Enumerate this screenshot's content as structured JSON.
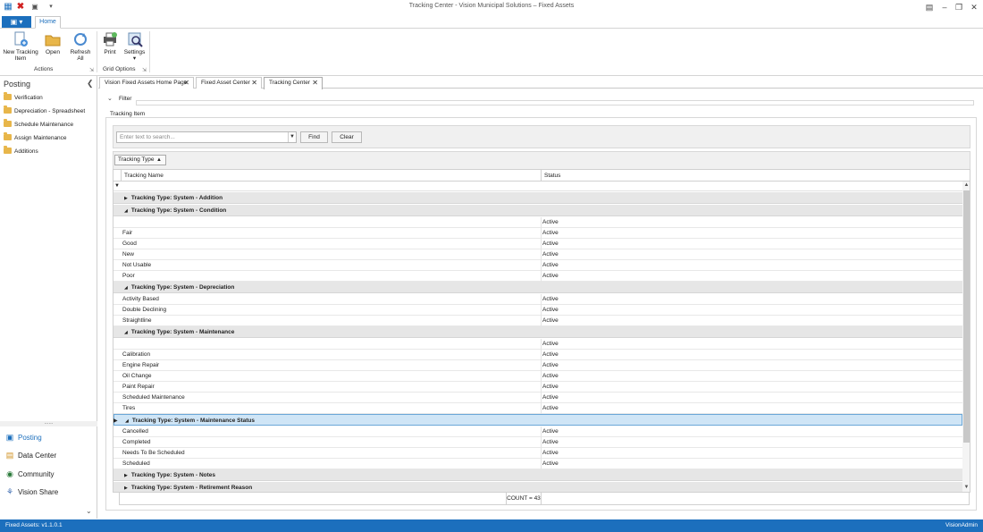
{
  "window": {
    "title": "Tracking Center - Vision Municipal Solutions – Fixed Assets",
    "buttons": [
      "❐",
      "–",
      "❐",
      "✕"
    ]
  },
  "ribbon": {
    "file_tab": "▣ ▾",
    "home_tab": "Home",
    "groups": [
      {
        "label": "Actions",
        "buttons": [
          "New Tracking Item",
          "Open",
          "Refresh All"
        ]
      },
      {
        "label": "Grid Options",
        "buttons": [
          "Print",
          "Settings"
        ]
      }
    ],
    "new_tracking_l1": "New Tracking",
    "new_tracking_l2": "Item",
    "open": "Open",
    "refresh_l1": "Refresh",
    "refresh_l2": "All",
    "print": "Print",
    "settings": "Settings",
    "actions_label": "Actions",
    "grid_options_label": "Grid Options"
  },
  "nav": {
    "title": "Posting",
    "items": [
      "Verification",
      "Depreciation - Spreadsheet",
      "Schedule Maintenance",
      "Assign Maintenance",
      "Additions"
    ],
    "bottom": [
      "Posting",
      "Data Center",
      "Community",
      "Vision Share"
    ]
  },
  "doc_tabs": [
    "Vision Fixed Assets Home Page",
    "Fixed Asset Center",
    "Tracking Center"
  ],
  "filter": {
    "label": "Filter"
  },
  "tracking": {
    "label": "Tracking Item",
    "search_placeholder": "Enter text to search...",
    "find": "Find",
    "clear": "Clear",
    "group_chip": "Tracking Type"
  },
  "grid": {
    "columns": [
      "Tracking Name",
      "Status"
    ],
    "rows": [
      {
        "type": "group",
        "expanded": false,
        "label": "Tracking Type: System - Addition"
      },
      {
        "type": "group",
        "expanded": true,
        "label": "Tracking Type: System - Condition"
      },
      {
        "type": "data",
        "name": "",
        "status": "Active"
      },
      {
        "type": "data",
        "name": "Fair",
        "status": "Active"
      },
      {
        "type": "data",
        "name": "Good",
        "status": "Active"
      },
      {
        "type": "data",
        "name": "New",
        "status": "Active"
      },
      {
        "type": "data",
        "name": "Not Usable",
        "status": "Active"
      },
      {
        "type": "data",
        "name": "Poor",
        "status": "Active"
      },
      {
        "type": "group",
        "expanded": true,
        "label": "Tracking Type: System - Depreciation"
      },
      {
        "type": "data",
        "name": "Activity Based",
        "status": "Active"
      },
      {
        "type": "data",
        "name": "Double Declining",
        "status": "Active"
      },
      {
        "type": "data",
        "name": "Straightline",
        "status": "Active"
      },
      {
        "type": "group",
        "expanded": true,
        "label": "Tracking Type: System - Maintenance"
      },
      {
        "type": "data",
        "name": "",
        "status": "Active"
      },
      {
        "type": "data",
        "name": "Calibration",
        "status": "Active"
      },
      {
        "type": "data",
        "name": "Engine Repair",
        "status": "Active"
      },
      {
        "type": "data",
        "name": "Oil Change",
        "status": "Active"
      },
      {
        "type": "data",
        "name": "Paint Repair",
        "status": "Active"
      },
      {
        "type": "data",
        "name": "Scheduled Maintenance",
        "status": "Active"
      },
      {
        "type": "data",
        "name": "Tires",
        "status": "Active"
      },
      {
        "type": "group",
        "expanded": true,
        "selected": true,
        "label": "Tracking Type: System - Maintenance Status"
      },
      {
        "type": "data",
        "name": "Cancelled",
        "status": "Active"
      },
      {
        "type": "data",
        "name": "Completed",
        "status": "Active"
      },
      {
        "type": "data",
        "name": "Needs To Be Scheduled",
        "status": "Active"
      },
      {
        "type": "data",
        "name": "Scheduled",
        "status": "Active"
      },
      {
        "type": "group",
        "expanded": false,
        "label": "Tracking Type: System - Notes"
      },
      {
        "type": "group",
        "expanded": false,
        "label": "Tracking Type: System - Retirement Reason"
      }
    ],
    "count": "COUNT = 43"
  },
  "status": {
    "app": "Fixed Assets: v1.1.0.1",
    "user": "VisionAdmin"
  },
  "colors": {
    "accent": "#1c6fbd",
    "group_row": "#e6e6e6",
    "selected_row": "#cfe5f6"
  }
}
